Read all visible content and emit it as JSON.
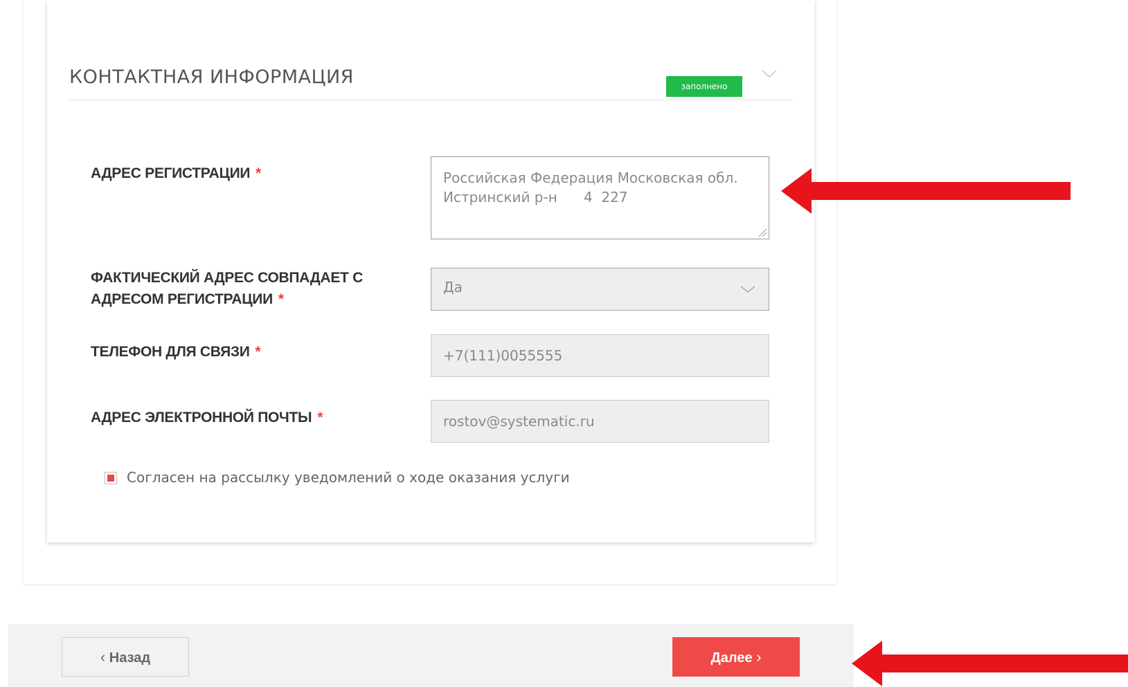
{
  "section": {
    "title": "КОНТАКТНАЯ ИНФОРМАЦИЯ",
    "status_badge": "заполнено",
    "collapse_icon": "chevron-down-icon"
  },
  "form": {
    "required_mark": "*",
    "registration_address": {
      "label": "АДРЕС РЕГИСТРАЦИИ",
      "value": "Российская Федерация Московская обл.\nИстринский р-н      4  227"
    },
    "actual_address_same": {
      "label_line1": "ФАКТИЧЕСКИЙ АДРЕС СОВПАДАЕТ С",
      "label_line2": "АДРЕСОМ РЕГИСТРАЦИИ",
      "selected": "Да"
    },
    "phone": {
      "label": "ТЕЛЕФОН ДЛЯ СВЯЗИ",
      "value": "+7(111)0055555"
    },
    "email": {
      "label": "АДРЕС ЭЛЕКТРОННОЙ ПОЧТЫ",
      "value": "rostov@systematic.ru"
    },
    "notifications_consent": {
      "label": "Согласен на рассылку уведомлений о ходе оказания услуги",
      "checked": true
    }
  },
  "footer": {
    "back_label": "Назад",
    "back_chevron": "‹",
    "next_label": "Далее",
    "next_chevron": "›"
  },
  "colors": {
    "accent_red": "#f04a48",
    "badge_green": "#22bb4b",
    "annotation_arrow": "#e8141c"
  }
}
